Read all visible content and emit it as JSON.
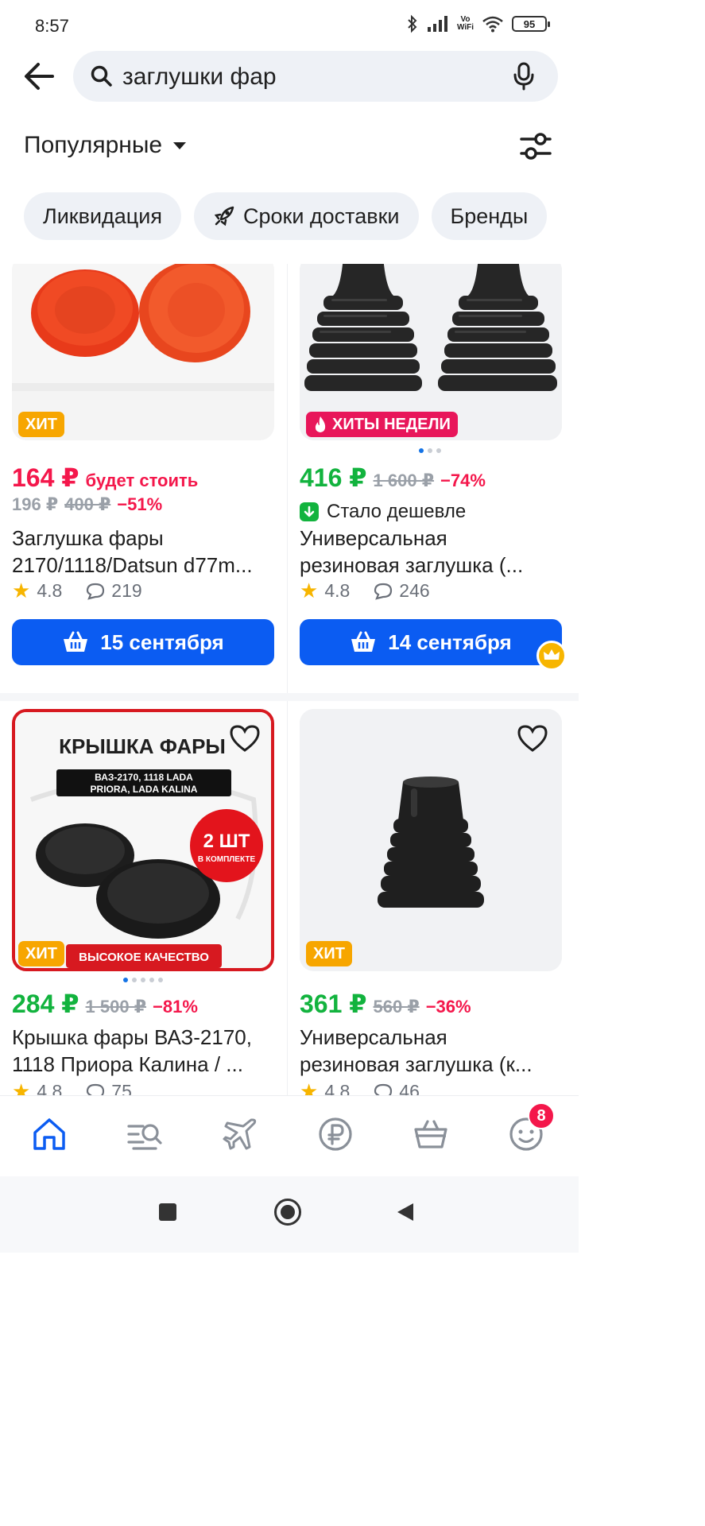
{
  "status_bar": {
    "time": "8:57",
    "volte_top": "Vo",
    "volte_bottom": "WiFi",
    "battery": "95"
  },
  "search": {
    "query": "заглушки фар"
  },
  "sort": {
    "label": "Популярные"
  },
  "chips": [
    {
      "label": "Ликвидация"
    },
    {
      "label": "Сроки доставки",
      "icon": "rocket-icon"
    },
    {
      "label": "Бренды"
    }
  ],
  "products": [
    {
      "badge": "ХИТ",
      "price": "164 ₽",
      "future_label": "будет стоить",
      "old_price_plain": "196 ₽",
      "old_price": "400 ₽",
      "discount": "−51%",
      "title_line1": "Заглушка фары",
      "title_line2": "2170/1118/Datsun d77m...",
      "rating": "4.8",
      "reviews": "219",
      "delivery": "15 сентября"
    },
    {
      "badge": "ХИТЫ НЕДЕЛИ",
      "price": "416 ₽",
      "old_price": "1 600 ₽",
      "discount": "−74%",
      "cheaper_label": "Стало дешевле",
      "title_line1": "Универсальная",
      "title_line2": "резиновая заглушка (...",
      "rating": "4.8",
      "reviews": "246",
      "delivery": "14 сентября"
    },
    {
      "badge": "ХИТ",
      "image_text": {
        "heading": "КРЫШКА ФАРЫ",
        "models_line1": "ВАЗ-2170, 1118 LADA",
        "models_line2": "PRIORA, LADA KALINA",
        "qty": "2 ШТ",
        "qty_sub": "В КОМПЛЕКТЕ",
        "quality": "ВЫСОКОЕ КАЧЕСТВО"
      },
      "price": "284 ₽",
      "old_price": "1 500 ₽",
      "discount": "−81%",
      "title_line1": "Крышка фары ВАЗ-2170,",
      "title_line2": "1118 Приора Калина / ...",
      "rating": "4.8",
      "reviews": "75"
    },
    {
      "badge": "ХИТ",
      "price": "361 ₽",
      "old_price": "560 ₽",
      "discount": "−36%",
      "title_line1": "Универсальная",
      "title_line2": "резиновая заглушка (к...",
      "rating": "4.8",
      "reviews": "46"
    }
  ],
  "bottom_nav": {
    "items": [
      {
        "icon": "home-icon",
        "active": true
      },
      {
        "icon": "catalog-search-icon"
      },
      {
        "icon": "airplane-icon"
      },
      {
        "icon": "ruble-icon"
      },
      {
        "icon": "basket-icon"
      },
      {
        "icon": "profile-face-icon",
        "badge": "8"
      }
    ]
  },
  "colors": {
    "accent_blue": "#0b5cf2",
    "price_red": "#f4174b",
    "price_green": "#12b33e",
    "hit_orange": "#f7a600",
    "week_pink": "#e8165a"
  }
}
